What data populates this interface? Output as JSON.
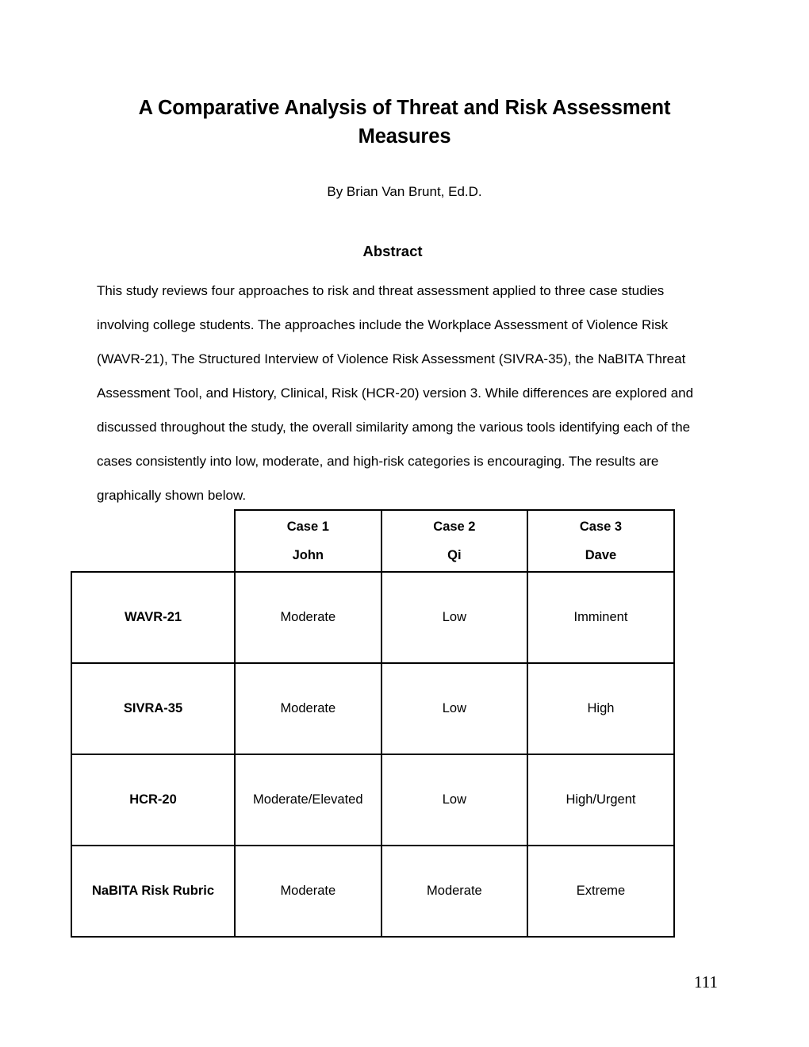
{
  "document": {
    "title": "A Comparative Analysis of Threat and Risk Assessment Measures",
    "byline": "By Brian Van Brunt, Ed.D.",
    "page_number": "111"
  },
  "abstract": {
    "heading": "Abstract",
    "body": "This study reviews four approaches to risk and threat assessment applied to three case studies involving college students. The approaches include the Workplace Assessment of Violence Risk (WAVR-21), The Structured Interview of Violence Risk Assessment (SIVRA-35), the NaBITA Threat Assessment Tool, and History, Clinical, Risk (HCR-20) version 3. While differences are explored and discussed throughout the study, the overall similarity among the various tools identifying each of the cases consistently into low, moderate, and high-risk categories is encouraging. The results are graphically shown below."
  },
  "table": {
    "corner_label": "",
    "columns": [
      {
        "case_no": "Case 1",
        "case_name": "John"
      },
      {
        "case_no": "Case 2",
        "case_name": "Qi"
      },
      {
        "case_no": "Case 3",
        "case_name": "Dave"
      }
    ],
    "rows": [
      {
        "label": "WAVR-21",
        "values": [
          "Moderate",
          "Low",
          "Imminent"
        ]
      },
      {
        "label": "SIVRA-35",
        "values": [
          "Moderate",
          "Low",
          "High"
        ]
      },
      {
        "label": "HCR-20",
        "values": [
          "Moderate/Elevated",
          "Low",
          "High/Urgent"
        ]
      },
      {
        "label": "NaBITA Risk Rubric",
        "values": [
          "Moderate",
          "Moderate",
          "Extreme"
        ]
      }
    ]
  }
}
